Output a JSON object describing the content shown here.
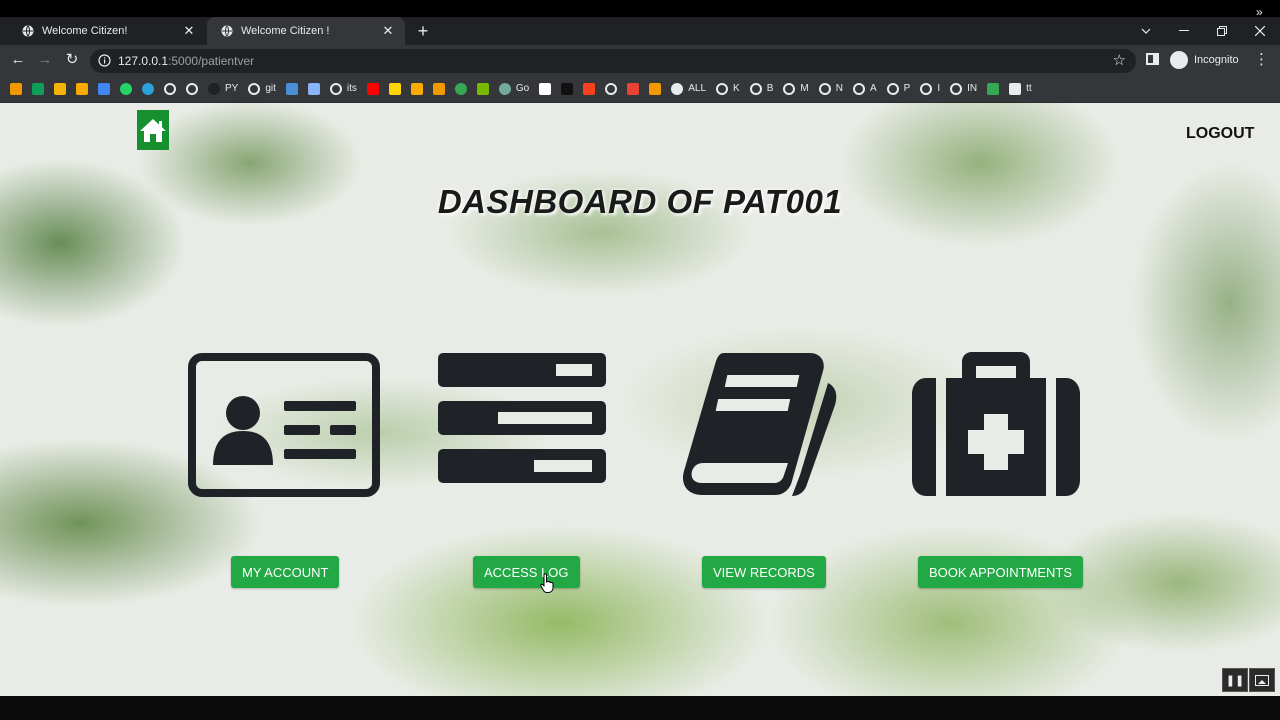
{
  "browser": {
    "tabs": [
      {
        "title": "Welcome Citizen!",
        "active": false
      },
      {
        "title": "Welcome Citizen !",
        "active": true
      }
    ],
    "url_host": "127.0.0.1",
    "url_rest": ":5000/patientver",
    "profile_label": "Incognito",
    "bookmarks": [
      {
        "label": "",
        "icon": "orange-diamond",
        "color": "#f29900"
      },
      {
        "label": "",
        "icon": "green-plus",
        "color": "#0f9d58"
      },
      {
        "label": "",
        "icon": "yellow-box",
        "color": "#f4b400"
      },
      {
        "label": "",
        "icon": "bar-chart",
        "color": "#f9ab00"
      },
      {
        "label": "",
        "icon": "blue-grid",
        "color": "#4285f4"
      },
      {
        "label": "",
        "icon": "whatsapp",
        "color": "#25d366"
      },
      {
        "label": "",
        "icon": "telegram",
        "color": "#2aa1da"
      },
      {
        "label": "",
        "icon": "google",
        "color": "#e8eaed"
      },
      {
        "label": "",
        "icon": "google",
        "color": "#e8eaed"
      },
      {
        "label": "PY",
        "icon": "github",
        "color": "#202124"
      },
      {
        "label": "git",
        "icon": "google",
        "color": "#e8eaed"
      },
      {
        "label": "",
        "icon": "blue-square",
        "color": "#4a90d9"
      },
      {
        "label": "",
        "icon": "car",
        "color": "#8ab4f8"
      },
      {
        "label": "its",
        "icon": "google",
        "color": "#e8eaed"
      },
      {
        "label": "",
        "icon": "youtube",
        "color": "#ff0000"
      },
      {
        "label": "",
        "icon": "p-yellow",
        "color": "#ffd400"
      },
      {
        "label": "",
        "icon": "cake",
        "color": "#f9ab00"
      },
      {
        "label": "",
        "icon": "trophy",
        "color": "#f29900"
      },
      {
        "label": "",
        "icon": "green-ring",
        "color": "#34a853"
      },
      {
        "label": "",
        "icon": "nvidia",
        "color": "#76b900"
      },
      {
        "label": "Go",
        "icon": "chatgpt",
        "color": "#74aa9c"
      },
      {
        "label": "",
        "icon": "white-doc",
        "color": "#ffffff"
      },
      {
        "label": "",
        "icon": "cl-black",
        "color": "#111111"
      },
      {
        "label": "",
        "icon": "yandex",
        "color": "#fc3f1d"
      },
      {
        "label": "",
        "icon": "google",
        "color": "#e8eaed"
      },
      {
        "label": "",
        "icon": "red-arrow",
        "color": "#ea4335"
      },
      {
        "label": "",
        "icon": "orange-badge",
        "color": "#f29900"
      },
      {
        "label": "ALL",
        "icon": "globe",
        "color": "#e8eaed"
      },
      {
        "label": "K",
        "icon": "google",
        "color": "#e8eaed"
      },
      {
        "label": "B",
        "icon": "google",
        "color": "#e8eaed"
      },
      {
        "label": "M",
        "icon": "google",
        "color": "#e8eaed"
      },
      {
        "label": "N",
        "icon": "google",
        "color": "#e8eaed"
      },
      {
        "label": "A",
        "icon": "google",
        "color": "#e8eaed"
      },
      {
        "label": "P",
        "icon": "google",
        "color": "#e8eaed"
      },
      {
        "label": "I",
        "icon": "google",
        "color": "#e8eaed"
      },
      {
        "label": "IN",
        "icon": "google",
        "color": "#e8eaed"
      },
      {
        "label": "",
        "icon": "green-pill",
        "color": "#34a853"
      },
      {
        "label": "tt",
        "icon": "monitor",
        "color": "#e8eaed"
      }
    ]
  },
  "page": {
    "logout_label": "LOGOUT",
    "heading": "DASHBOARD OF PAT001",
    "accent_color": "#22a844",
    "icon_color": "#1f2327",
    "buttons": {
      "my_account": "MY ACCOUNT",
      "access_log": "ACCESS LOG",
      "view_records": "VIEW RECORDS",
      "book_appointments": "BOOK APPOINTMENTS"
    }
  }
}
